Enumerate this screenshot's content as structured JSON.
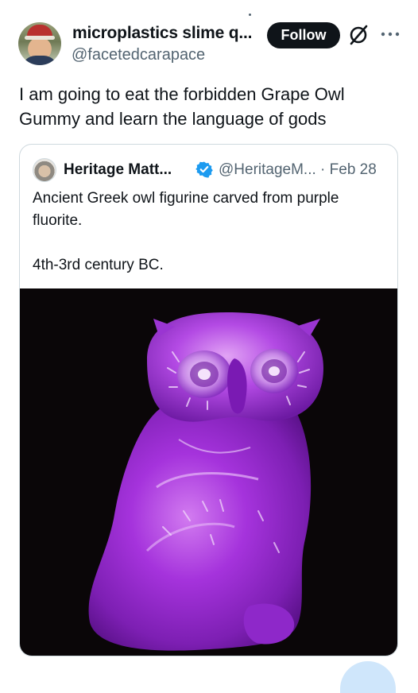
{
  "author": {
    "display_name": "microplastics slime q...",
    "handle": "@facetedcarapace"
  },
  "actions": {
    "follow_label": "Follow"
  },
  "icons": {
    "grok": "grok-icon",
    "more": "more-icon",
    "verified": "verified-badge-icon"
  },
  "tweet": {
    "text": "I am going to eat the forbidden Grape Owl Gummy and learn the language of gods"
  },
  "quote": {
    "display_name": "Heritage Matt...",
    "handle_date": "@HeritageM... · Feb 28",
    "text_line1": "Ancient Greek owl figurine carved from purple fluorite.",
    "text_line2": "4th-3rd century BC."
  },
  "colors": {
    "text": "#0f1419",
    "secondary": "#536471",
    "border": "#cfd9de",
    "verified": "#1d9bf0",
    "owl_purple": "#9a2bd8"
  }
}
